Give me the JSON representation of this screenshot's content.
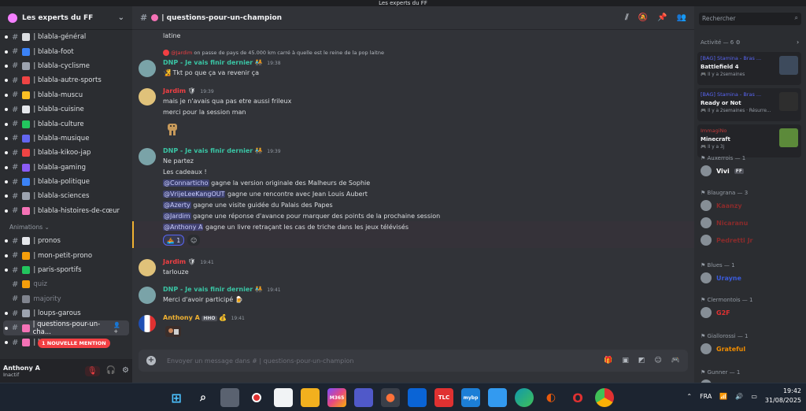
{
  "window": {
    "title": "Les experts du FF"
  },
  "server": {
    "name": "Les experts du FF"
  },
  "channels": [
    {
      "label": "| blabla-général",
      "color": "#dbdee1",
      "muted": false
    },
    {
      "label": "| blabla-foot",
      "color": "#3b82f6",
      "muted": false
    },
    {
      "label": "| blabla-cyclisme",
      "color": "#9ca3af",
      "muted": false
    },
    {
      "label": "| blabla-autre-sports",
      "color": "#ef4444",
      "muted": false
    },
    {
      "label": "| blabla-muscu",
      "color": "#fbbf24",
      "muted": false
    },
    {
      "label": "| blabla-cuisine",
      "color": "#e5e7eb",
      "muted": false
    },
    {
      "label": "| blabla-culture",
      "color": "#22c55e",
      "muted": false
    },
    {
      "label": "| blabla-musique",
      "color": "#6366f1",
      "muted": false
    },
    {
      "label": "| blabla-kikoo-jap",
      "color": "#ef4444",
      "muted": false
    },
    {
      "label": "| blabla-gaming",
      "color": "#8b5cf6",
      "muted": false
    },
    {
      "label": "| blabla-politique",
      "color": "#3b82f6",
      "muted": false
    },
    {
      "label": "| blabla-sciences",
      "color": "#9ca3af",
      "muted": false
    },
    {
      "label": "| blabla-histoires-de-cœur",
      "color": "#f472b6",
      "muted": false
    }
  ],
  "category_animations": "Animations ⌄",
  "anim_channels": [
    {
      "label": "| pronos",
      "color": "#e5e7eb",
      "muted": false
    },
    {
      "label": "| mon-petit-prono",
      "color": "#f59e0b",
      "muted": false
    },
    {
      "label": "| paris-sportifs",
      "color": "#22c55e",
      "muted": false
    },
    {
      "label": "quiz",
      "color": "#f59e0b",
      "muted": true
    },
    {
      "label": "majority",
      "color": "#80848e",
      "muted": true
    },
    {
      "label": "| loups-garous",
      "color": "#9ca3af",
      "muted": false
    },
    {
      "label": "| questions-pour-un-cha...",
      "color": "#f472b6",
      "muted": false,
      "active": true
    },
    {
      "label": "| khoudujourdrama",
      "color": "#f472b6",
      "muted": false
    }
  ],
  "new_mention": "1 NOUVELLE MENTION",
  "user": {
    "name": "Anthony A",
    "status": "Inactif"
  },
  "topbar": {
    "channel": "| questions-pour-un-champion"
  },
  "messages": {
    "m0": "latine",
    "reply1_name": "@Jardim",
    "reply1_text": "on passe de pays de 45.000 km carré à quelle est le reine de la pop laitne",
    "m1_author": "DNP - Je vais finir dernier",
    "m1_time": "19:38",
    "m1_text": "Tkt po que ça va revenir ça",
    "m2_author": "Jardim",
    "m2_time": "19:39",
    "m2_text1": "mais je n'avais qua pas etre aussi frileux",
    "m2_text2": "merci pour la session man",
    "m3_author": "DNP - Je vais finir dernier",
    "m3_time": "19:39",
    "m3_l1": "Ne partez",
    "m3_l2": "Les cadeaux !",
    "m3_l3_mention": "@Connarticho",
    "m3_l3_text": "gagne la version originale des Malheurs de Sophie",
    "m3_l4_mention": "@VrijeLeeKangOUT",
    "m3_l4_text": "gagne une rencontre avec Jean Louis Aubert",
    "m3_l5_mention": "@Azerty",
    "m3_l5_text": "gagne une visite guidée du Palais des Papes",
    "m3_l6_mention": "@Jardim",
    "m3_l6_text": "gagne une réponse d'avance pour marquer des points de la prochaine session",
    "m3_l7_mention": "@Anthony A",
    "m3_l7_text": "gagne un livre retraçant les cas de triche dans les jeux télévisés",
    "m3_reaction_count": "1",
    "m4_author": "Jardim",
    "m4_time": "19:41",
    "m4_text": "tarlouze",
    "m5_author": "DNP - Je vais finir dernier",
    "m5_time": "19:41",
    "m5_text": "Merci d'avoir participé",
    "m6_author": "Anthony A",
    "m6_tag": "HHO",
    "m6_time": "19:41"
  },
  "composer": {
    "placeholder": "Envoyer un message dans # | questions-pour-un-champion"
  },
  "search": {
    "placeholder": "Rechercher"
  },
  "activity": {
    "title": "Activité — 6",
    "cards": [
      {
        "who": "[BAG] Stamina - Bras ...",
        "game": "Battlefield 4",
        "when": "Il y a 2semaines"
      },
      {
        "who": "[BAG] Stamina - Bras ...",
        "game": "Ready or Not",
        "when": "Il y a 2semaines · Résurre..."
      },
      {
        "who": "ImmagiNo",
        "game": "Minecraft",
        "when": "Il y a 3j"
      }
    ]
  },
  "groups": [
    {
      "title": "Auxerrois — 1",
      "members": [
        {
          "name": "Vivi",
          "tag": "FF",
          "color": "#ffffff"
        }
      ]
    },
    {
      "title": "Blaugrana — 3",
      "members": [
        {
          "name": "Kaanzy",
          "color": "#8a2b2b"
        },
        {
          "name": "Nicaranu",
          "color": "#8a2b2b"
        },
        {
          "name": "Pedretti Jr",
          "color": "#8a2b2b"
        }
      ]
    },
    {
      "title": "Blues — 1",
      "members": [
        {
          "name": "Urayne",
          "color": "#3b5bdb"
        }
      ]
    },
    {
      "title": "Clermontois — 1",
      "members": [
        {
          "name": "G2F",
          "color": "#e03131"
        }
      ]
    },
    {
      "title": "Giallorossi — 1",
      "members": [
        {
          "name": "Grateful",
          "color": "#f08c00"
        }
      ]
    },
    {
      "title": "Gunner — 1",
      "members": [
        {
          "name": "AHramos",
          "color": "#e03131"
        }
      ]
    }
  ],
  "taskbar": {
    "lang": "FRA",
    "time": "19:42",
    "date": "31/08/2025",
    "m365": "M365",
    "tlc": "TLC",
    "mybp": "mybp"
  }
}
